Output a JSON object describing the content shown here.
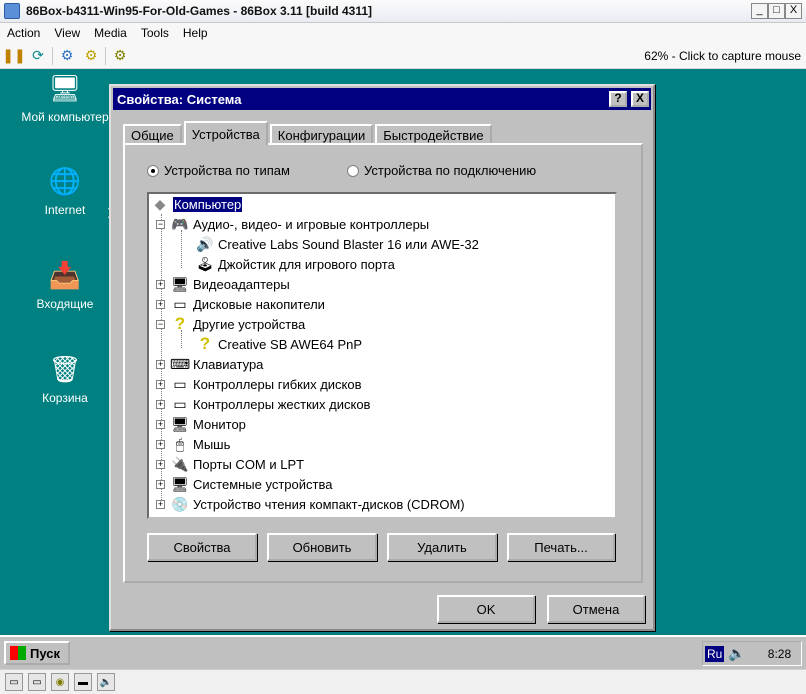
{
  "host": {
    "title": "86Box-b4311-Win95-For-Old-Games - 86Box 3.11 [build 4311]",
    "controls": {
      "minimize": "_",
      "maximize": "□",
      "close": "X"
    },
    "menu": [
      "Action",
      "View",
      "Media",
      "Tools",
      "Help"
    ],
    "capture_hint": "62% - Click to capture mouse"
  },
  "desktop": {
    "icons": [
      {
        "label": "Мой компьютер",
        "icon": "computer-icon"
      },
      {
        "label": "Internet",
        "icon": "internet-icon"
      },
      {
        "label": "Входящие",
        "icon": "inbox-icon"
      },
      {
        "label": "Корзина",
        "icon": "recycle-bin-icon"
      }
    ]
  },
  "dialog": {
    "title": "Свойства: Система",
    "help_btn": "?",
    "close_btn": "X",
    "tabs": [
      "Общие",
      "Устройства",
      "Конфигурации",
      "Быстродействие"
    ],
    "active_tab": "Устройства",
    "radio_by_type": "Устройства по типам",
    "radio_by_connection": "Устройства по подключению",
    "selected_radio": "by_type",
    "tree": [
      {
        "label": "Компьютер",
        "level": 0,
        "expander": "",
        "selected": true
      },
      {
        "label": "Аудио-, видео- и игровые контроллеры",
        "level": 1,
        "expander": "−"
      },
      {
        "label": "Creative Labs Sound Blaster 16 или AWE-32",
        "level": 2,
        "expander": ""
      },
      {
        "label": "Джойстик для игрового порта",
        "level": 2,
        "expander": ""
      },
      {
        "label": "Видеоадаптеры",
        "level": 1,
        "expander": "+"
      },
      {
        "label": "Дисковые накопители",
        "level": 1,
        "expander": "+"
      },
      {
        "label": "Другие устройства",
        "level": 1,
        "expander": "−"
      },
      {
        "label": "Creative SB AWE64 PnP",
        "level": 2,
        "expander": ""
      },
      {
        "label": "Клавиатура",
        "level": 1,
        "expander": "+"
      },
      {
        "label": "Контроллеры гибких дисков",
        "level": 1,
        "expander": "+"
      },
      {
        "label": "Контроллеры жестких дисков",
        "level": 1,
        "expander": "+"
      },
      {
        "label": "Монитор",
        "level": 1,
        "expander": "+"
      },
      {
        "label": "Мышь",
        "level": 1,
        "expander": "+"
      },
      {
        "label": "Порты COM и LPT",
        "level": 1,
        "expander": "+"
      },
      {
        "label": "Системные устройства",
        "level": 1,
        "expander": "+"
      },
      {
        "label": "Устройство чтения компакт-дисков (CDROM)",
        "level": 1,
        "expander": "+"
      }
    ],
    "buttons": {
      "properties": "Свойства",
      "refresh": "Обновить",
      "remove": "Удалить",
      "print": "Печать...",
      "ok": "OK",
      "cancel": "Отмена"
    }
  },
  "taskbar": {
    "start": "Пуск",
    "lang": "Ru",
    "clock": "8:28"
  }
}
